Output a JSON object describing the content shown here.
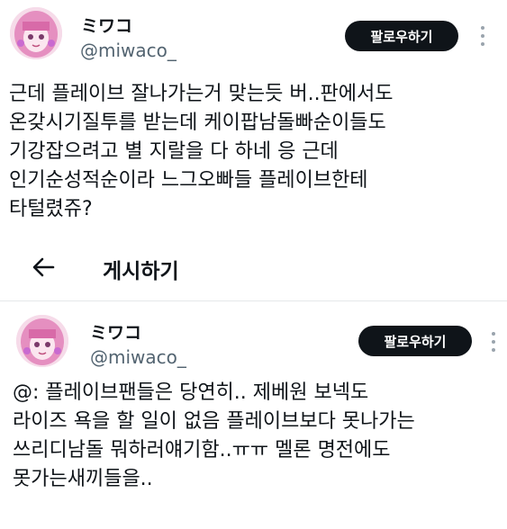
{
  "tweet1": {
    "display_name": "ミワコ",
    "handle": "@miwaco_",
    "follow_label": "팔로우하기",
    "text": "근데 플레이브 잘나가는거 맞는듯 버..판에서도\n온갖시기질투를 받는데 케이팝남돌빠순이들도\n기강잡으려고 별 지랄을 다 하네 응 근데\n인기순성적순이라 느그오빠들 플레이브한테\n타털렸쥬?"
  },
  "nav": {
    "back_label": "게시하기",
    "back_icon": "arrow-left-icon"
  },
  "tweet2": {
    "display_name": "ミワコ",
    "handle": "@miwaco_",
    "follow_label": "팔로우하기",
    "text": "@: 플레이브팬들은 당연히.. 제베원 보넥도\n라이즈 욕을 할 일이 없음 플레이브보다 못나가는\n쓰리디남돌 뭐하러얘기함..ㅠㅠ 멜론 명전에도\n못가는새끼들을.."
  },
  "colors": {
    "text": "#0f1419",
    "secondary_text": "#536471",
    "button_bg": "#0f1419",
    "button_text": "#ffffff",
    "divider": "#e6e8ea"
  }
}
